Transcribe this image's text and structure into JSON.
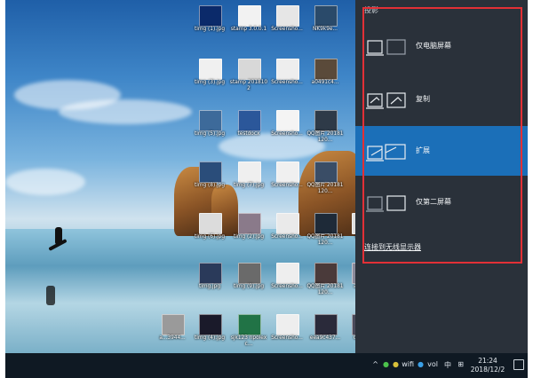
{
  "panel": {
    "title": "投影",
    "options": [
      {
        "label": "仅电脑屏幕",
        "selected": false
      },
      {
        "label": "复制",
        "selected": false
      },
      {
        "label": "扩展",
        "selected": true
      },
      {
        "label": "仅第二屏幕",
        "selected": false
      }
    ],
    "wireless_link": "连接到无线显示器"
  },
  "desktop_icons": [
    {
      "label": "timg (1).jpg",
      "thumb": "#0b2a6a"
    },
    {
      "label": "stamp 3.0.0.1",
      "thumb": "#f2f2f2"
    },
    {
      "label": "Screensho...",
      "thumb": "#e6e6e6"
    },
    {
      "label": "NK9k9e...",
      "thumb": "#2a4a6a"
    },
    {
      "label": "timg (3).jpg",
      "thumb": "#f0f0f0"
    },
    {
      "label": "stamp 2018102",
      "thumb": "#d8d8d8"
    },
    {
      "label": "Screensho...",
      "thumb": "#eeeeee"
    },
    {
      "label": "a0491c4...",
      "thumb": "#5a4a3a"
    },
    {
      "label": "timg (5).jpg",
      "thumb": "#3d6a9a"
    },
    {
      "label": "testdocx",
      "thumb": "#2b579a"
    },
    {
      "label": "Screensho...",
      "thumb": "#f4f4f4"
    },
    {
      "label": "QQ图片 20181120...",
      "thumb": "#2e3a48"
    },
    {
      "label": "timg (8).jpg",
      "thumb": "#2a4d7a"
    },
    {
      "label": "timg (7).jpg",
      "thumb": "#efefef"
    },
    {
      "label": "Screensho...",
      "thumb": "#f0f0f0"
    },
    {
      "label": "QQ图片 20181120...",
      "thumb": "#3a4d66"
    },
    {
      "label": "timg (6).jpg",
      "thumb": "#dcdcdc"
    },
    {
      "label": "timg (2).jpg",
      "thumb": "#8a7a8a"
    },
    {
      "label": "Screensho...",
      "thumb": "#eaeaea"
    },
    {
      "label": "QQ图片 20181120...",
      "thumb": "#1e2a38"
    },
    {
      "label": "a50...",
      "thumb": "#e0e0e0"
    },
    {
      "label": "timg.jpg",
      "thumb": "#2a3a5a"
    },
    {
      "label": "timg (9).jpg",
      "thumb": "#6a6a6a"
    },
    {
      "label": "Screensho...",
      "thumb": "#eeeeee"
    },
    {
      "label": "QQ图片 20181120...",
      "thumb": "#4a3a3a"
    },
    {
      "label": "abc9...",
      "thumb": "#8a8a9a"
    },
    {
      "label": "a...3944...",
      "thumb": "#9a9a9a"
    },
    {
      "label": "timg (4).jpg",
      "thumb": "#1a1a2a"
    },
    {
      "label": "sjk123 npoiexc...",
      "thumb": "#217346"
    },
    {
      "label": "Screensho...",
      "thumb": "#eeeeee"
    },
    {
      "label": "eea9c437...",
      "thumb": "#2a2a3a"
    },
    {
      "label": "d116...",
      "thumb": "#4a4a5a"
    }
  ],
  "taskbar": {
    "tray_icons": [
      "^",
      "●",
      "●",
      "wifi",
      "●",
      "vol",
      "中",
      "⊞"
    ],
    "time": "21:24",
    "date": "2018/12/2"
  }
}
